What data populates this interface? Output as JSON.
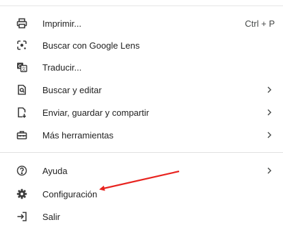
{
  "menu": {
    "items": [
      {
        "icon": "printer-icon",
        "label": "Imprimir...",
        "shortcut": "Ctrl + P"
      },
      {
        "icon": "google-lens-icon",
        "label": "Buscar con Google Lens"
      },
      {
        "icon": "translate-icon",
        "label": "Traducir..."
      },
      {
        "icon": "find-edit-icon",
        "label": "Buscar y editar"
      },
      {
        "icon": "send-save-icon",
        "label": "Enviar, guardar y compartir"
      },
      {
        "icon": "toolbox-icon",
        "label": "Más herramientas"
      },
      {
        "icon": "help-icon",
        "label": "Ayuda"
      },
      {
        "icon": "gear-icon",
        "label": "Configuración"
      },
      {
        "icon": "exit-icon",
        "label": "Salir"
      }
    ]
  },
  "annotation": {
    "arrow_color": "#e8231f"
  }
}
